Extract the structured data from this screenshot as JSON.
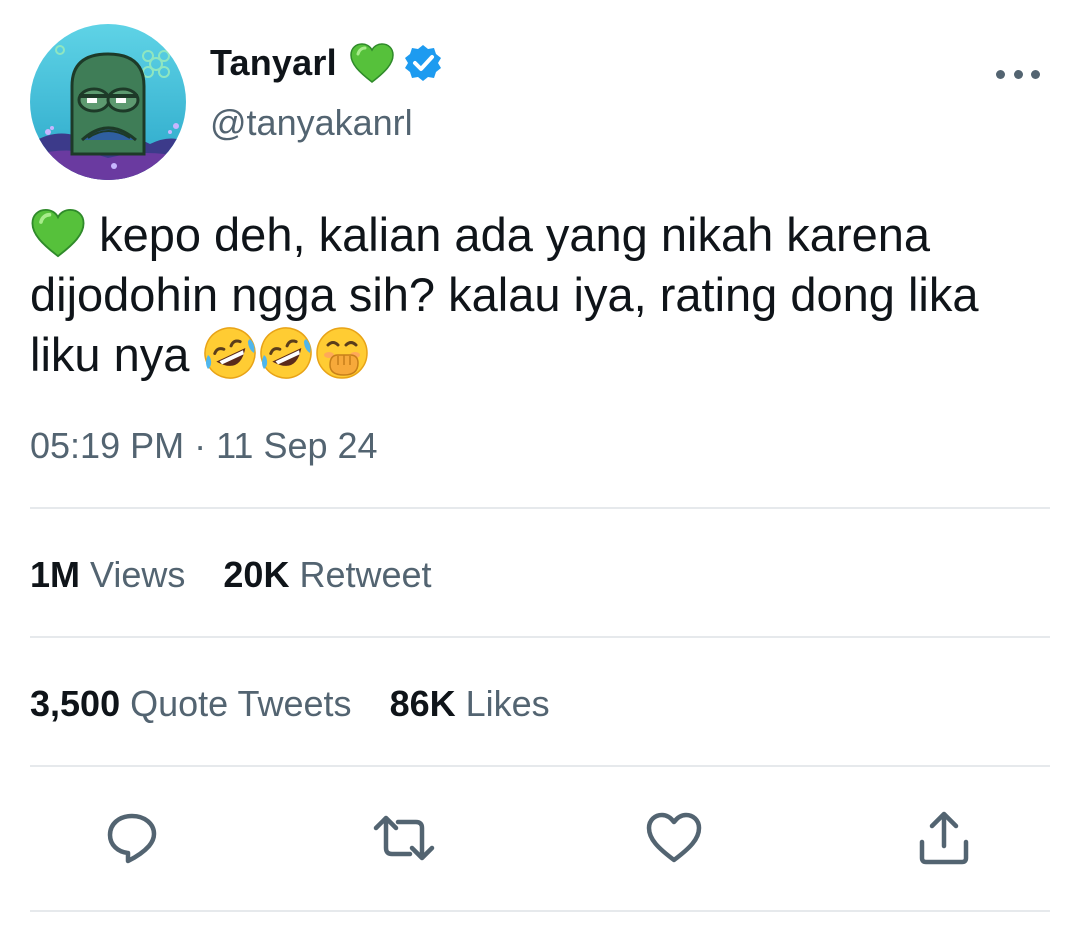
{
  "user": {
    "display_name": "Tanyarl",
    "handle": "@tanyakanrl",
    "name_badge_icon": "green-heart-icon",
    "verified_icon": "verified-badge-icon",
    "avatar_icon": "cartoon-fish-avatar"
  },
  "tweet": {
    "lines": [
      "kepo deh, kalian ada yang nikah karena",
      "dijodohin ngga sih? kalau iya, rating dong lika",
      "liku nya"
    ],
    "leading_emoji": "green-heart-icon",
    "trailing_emojis": [
      "rolling-on-floor-laughing-icon",
      "rolling-on-floor-laughing-icon",
      "hand-over-mouth-icon"
    ],
    "timestamp": "05:19 PM · 11 Sep 24"
  },
  "stats": {
    "views_count": "1M",
    "views_label": "Views",
    "retweets_count": "20K",
    "retweets_label": "Retweet",
    "quotes_count": "3,500",
    "quotes_label": "Quote Tweets",
    "likes_count": "86K",
    "likes_label": "Likes"
  },
  "actions": [
    "reply-icon",
    "retweet-icon",
    "like-icon",
    "share-icon"
  ],
  "colors": {
    "text": "#0f1419",
    "secondary": "#536471",
    "divider": "#e6e9ec",
    "verified": "#1d9bf0",
    "green_heart": "#4caf50"
  }
}
